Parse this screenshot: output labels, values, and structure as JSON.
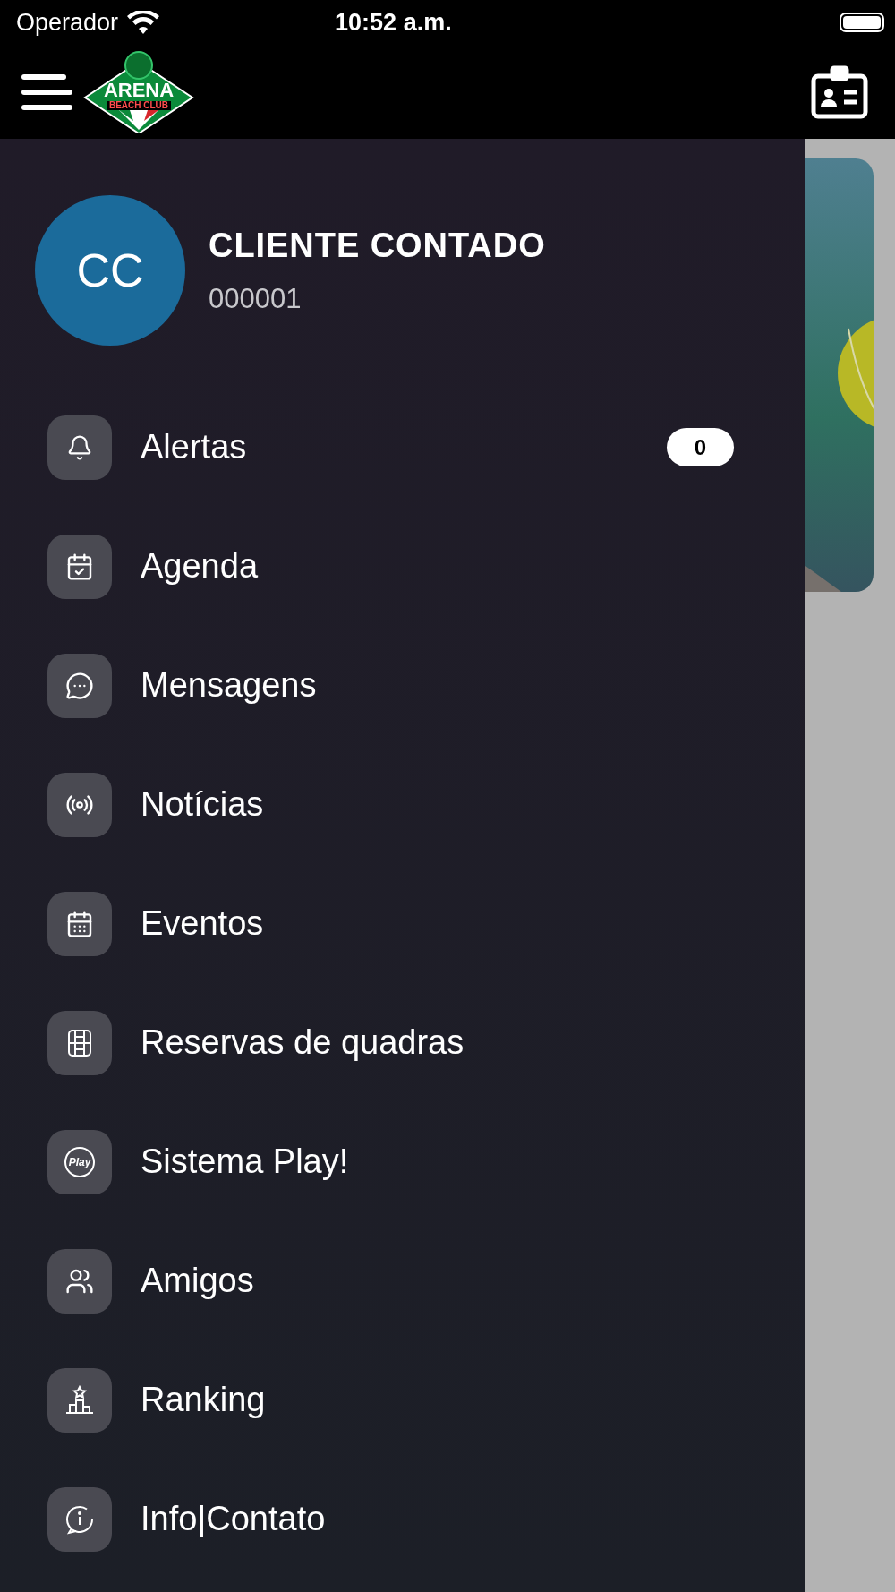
{
  "status_bar": {
    "carrier": "Operador",
    "time": "10:52 a.m."
  },
  "header": {
    "logo": {
      "wordmark": "ARENA",
      "tagline": "BEACH CLUB"
    }
  },
  "profile": {
    "initials": "CC",
    "name": "CLIENTE CONTADO",
    "code": "000001"
  },
  "menu": [
    {
      "label": "Alertas",
      "badge": "0"
    },
    {
      "label": "Agenda"
    },
    {
      "label": "Mensagens"
    },
    {
      "label": "Notícias"
    },
    {
      "label": "Eventos"
    },
    {
      "label": "Reservas de quadras"
    },
    {
      "label": "Sistema Play!",
      "icon_text": "Play"
    },
    {
      "label": "Amigos"
    },
    {
      "label": "Ranking"
    },
    {
      "label": "Info|Contato"
    }
  ]
}
